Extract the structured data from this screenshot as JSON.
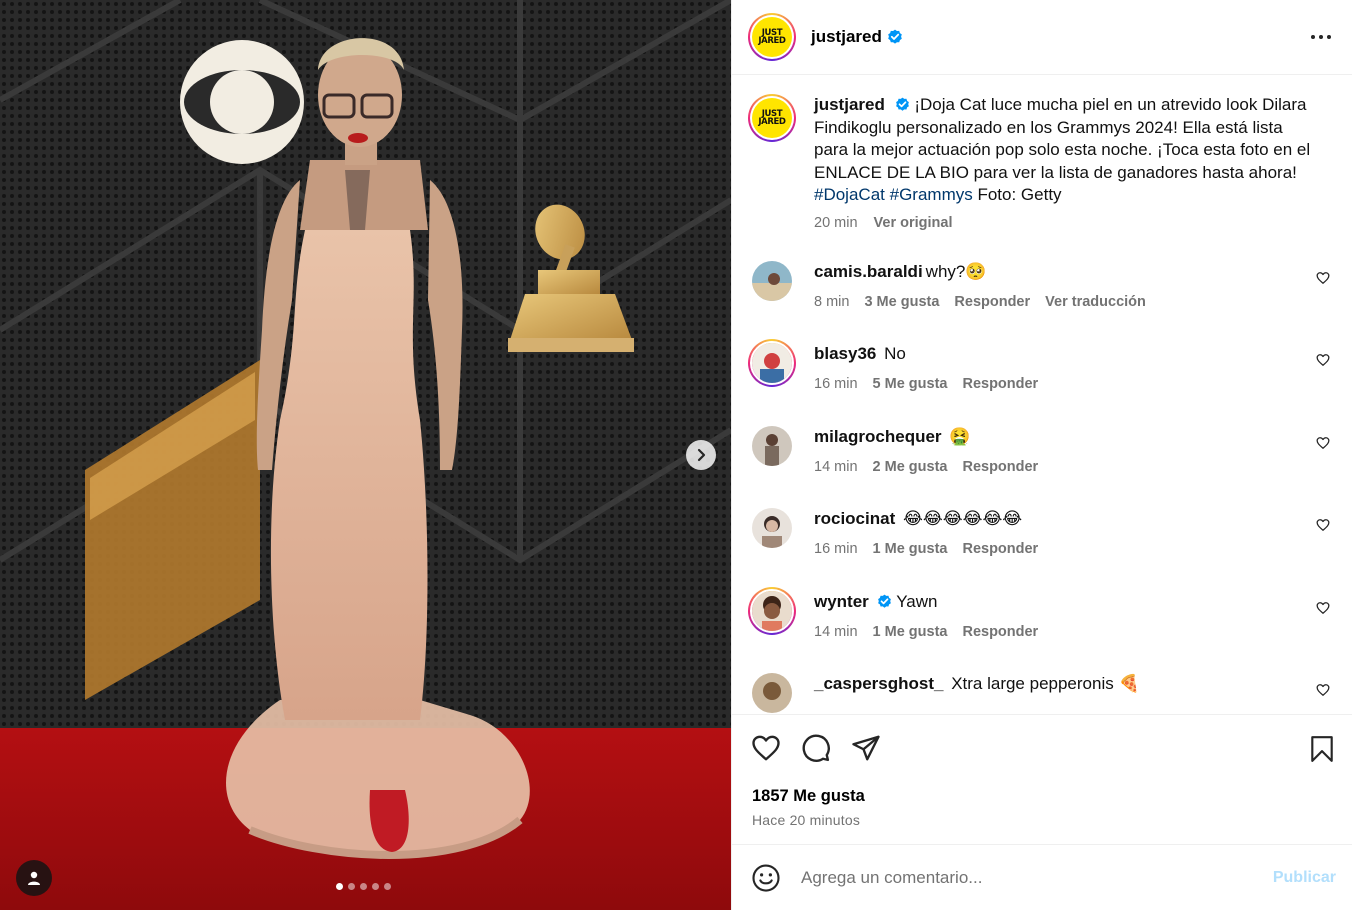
{
  "post": {
    "account": "justjared",
    "avatar_logo_line1": "JUST",
    "avatar_logo_line2": "JARED",
    "verified": true,
    "caption_text": "¡Doja Cat luce mucha piel en un atrevido look Dilara Findikoglu personalizado en los Grammys 2024! Ella está lista para la mejor actuación pop solo esta noche. ¡Toca esta foto en el ENLACE DE LA BIO para ver la lista de ganadores hasta ahora!",
    "hashtags": [
      "#DojaCat",
      "#Grammys"
    ],
    "caption_tail": "Foto: Getty",
    "caption_age": "20 min",
    "see_original": "Ver original",
    "carousel_count": 5,
    "carousel_index": 1
  },
  "comments": [
    {
      "user": "camis.baraldi",
      "text": "why?🥺",
      "age": "8 min",
      "likes": "3 Me gusta",
      "reply": "Responder",
      "translate": "Ver traducción",
      "verified": false,
      "avatar": "beach"
    },
    {
      "user": "blasy36",
      "text": "No",
      "age": "16 min",
      "likes": "5 Me gusta",
      "reply": "Responder",
      "translate": "",
      "verified": false,
      "avatar": "story"
    },
    {
      "user": "milagrochequer",
      "text": "🤮",
      "age": "14 min",
      "likes": "2 Me gusta",
      "reply": "Responder",
      "translate": "",
      "verified": false,
      "avatar": "person"
    },
    {
      "user": "rociocinat",
      "text": "😂😂😂😂😂😂",
      "age": "16 min",
      "likes": "1 Me gusta",
      "reply": "Responder",
      "translate": "",
      "verified": false,
      "avatar": "selfie"
    },
    {
      "user": "wynter",
      "text": "Yawn",
      "age": "14 min",
      "likes": "1 Me gusta",
      "reply": "Responder",
      "translate": "",
      "verified": true,
      "avatar": "story-child"
    },
    {
      "user": "_caspersghost_",
      "text": "Xtra large pepperonis 🍕",
      "age": "",
      "likes": "",
      "reply": "",
      "translate": "",
      "verified": false,
      "avatar": "portrait"
    }
  ],
  "stats": {
    "likes_label": "1857 Me gusta",
    "posted": "Hace 20 minutos"
  },
  "composer": {
    "placeholder": "Agrega un comentario...",
    "publish_label": "Publicar"
  },
  "colors": {
    "verified": "#0095f6",
    "hashtag": "#00376b",
    "publish_disabled": "#b2dffc",
    "secondary_text": "#737373",
    "brand_yellow": "#ffe500"
  },
  "icons": [
    "more-options-icon",
    "verified-badge-icon",
    "heart-icon",
    "comment-icon",
    "share-icon",
    "bookmark-icon",
    "emoji-icon",
    "chevron-right-icon",
    "user-tag-icon"
  ]
}
